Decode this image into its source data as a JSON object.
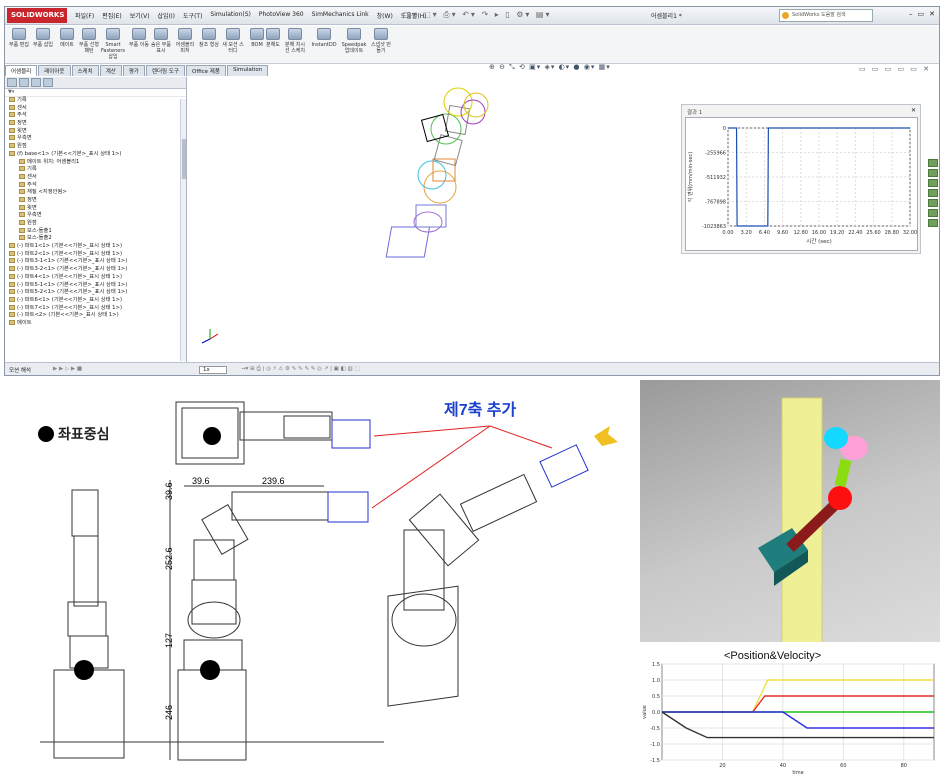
{
  "app": {
    "logo": "SOLIDWORKS",
    "menu": [
      "파일(F)",
      "편집(E)",
      "보기(V)",
      "삽입(I)",
      "도구(T)",
      "Simulation(S)",
      "PhotoView 360",
      "SimMechanics Link",
      "창(W)",
      "도움말(H)"
    ],
    "doc_title": "어셈블리1 *",
    "help_placeholder": "SolidWorks 도움말 검색"
  },
  "commands": [
    "부품 편집",
    "부품 삽입",
    "메이트",
    "부품 선형 패턴",
    "Smart Fasteners 삽입",
    "부품 이동",
    "숨은 부품 표시",
    "어셈블리 피처",
    "참조 형상",
    "새 모션 스터디",
    "BOM",
    "분해도",
    "분해 지시선 스케치",
    "InstantDD",
    "Speedpak 업데이트",
    "스냅샷 만들기"
  ],
  "tabs": [
    "어셈블리",
    "레이아웃",
    "스케치",
    "계산",
    "평가",
    "렌더링 도구",
    "Office 제품",
    "Simulation"
  ],
  "tree": [
    "기록",
    "센서",
    "주석",
    "정면",
    "윗면",
    "우측면",
    "원점",
    "(f) base<1> (기본<<기본>_표시 상태 1>)",
    "메이트 위치: 어셈블리1",
    "기록",
    "센서",
    "주석",
    "재질 <지정안됨>",
    "정면",
    "윗면",
    "우측면",
    "원점",
    "보스-돌출1",
    "보스-돌출2",
    "(-) 파트1<1> (기본<<기본>_표시 상태 1>)",
    "(-) 파트2<1> (기본<<기본>_표시 상태 1>)",
    "(-) 파트3-1<1> (기본<<기본>_표시 상태 1>)",
    "(-) 파트3-2<1> (기본<<기본>_표시 상태 1>)",
    "(-) 파트4<1> (기본<<기본>_표시 상태 1>)",
    "(-) 파트5-1<1> (기본<<기본>_표시 상태 1>)",
    "(-) 파트5-2<1> (기본<<기본>_표시 상태 1>)",
    "(-) 파트6<1> (기본<<기본>_표시 상태 1>)",
    "(-) 파트7<1> (기본<<기본>_표시 상태 1>)",
    "(-) 파트<2> (기본<<기본>_표시 상태 1>)",
    "메이트"
  ],
  "results": {
    "title": "결과 1",
    "chart_data": {
      "type": "line",
      "xlabel": "시간 (sec)",
      "ylabel": "각 변위(mm/min-sec)",
      "x_ticks": [
        "0.00",
        "3.20",
        "6.40",
        "9.60",
        "12.80",
        "16.00",
        "19.20",
        "22.40",
        "25.60",
        "28.80",
        "32.00"
      ],
      "y_ticks": [
        "0",
        "-255966",
        "-511932",
        "-767898",
        "-1023863"
      ],
      "xlim": [
        0,
        32
      ],
      "ylim": [
        -1023863,
        0
      ],
      "series": [
        {
          "x": [
            0,
            1.5,
            1.6,
            7.0,
            7.1,
            32
          ],
          "values": [
            0,
            0,
            -1023863,
            -1023863,
            0,
            0
          ]
        }
      ]
    }
  },
  "statusbar": {
    "left": "모션 해석",
    "zoom": "1x"
  },
  "drawing": {
    "legend": "좌표중심",
    "axis7": "제7축 추가",
    "dims": [
      "39.6",
      "239.6",
      "39.6",
      "252.6",
      "127",
      "246"
    ]
  },
  "posvel": {
    "title": "<Position&Velocity>",
    "chart_data": {
      "type": "line",
      "xlabel": "time",
      "ylabel": "value",
      "x_ticks": [
        "20",
        "40",
        "60",
        "80"
      ],
      "y_ticks": [
        "1.5",
        "1.0",
        "0.5",
        "0.0",
        "-0.5",
        "-1.0",
        "-1.5"
      ],
      "xlim": [
        0,
        90
      ],
      "ylim": [
        -1.5,
        1.5
      ],
      "series": [
        {
          "color": "#f0e040",
          "x": [
            0,
            30,
            35,
            90
          ],
          "values": [
            0,
            0,
            1.0,
            1.0
          ]
        },
        {
          "color": "#e03030",
          "x": [
            0,
            30,
            34,
            90
          ],
          "values": [
            0,
            0,
            0.5,
            0.5
          ]
        },
        {
          "color": "#20c020",
          "x": [
            0,
            90
          ],
          "values": [
            0,
            0
          ]
        },
        {
          "color": "#3030e0",
          "x": [
            0,
            40,
            48,
            90
          ],
          "values": [
            0,
            0,
            -0.5,
            -0.5
          ]
        },
        {
          "color": "#333333",
          "x": [
            0,
            8,
            15,
            90
          ],
          "values": [
            0,
            -0.5,
            -0.8,
            -0.8
          ]
        }
      ]
    }
  }
}
